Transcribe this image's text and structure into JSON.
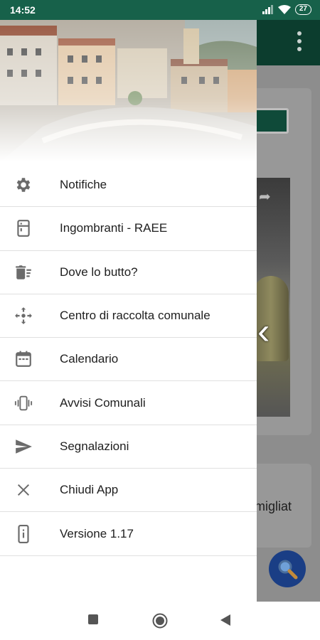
{
  "status_bar": {
    "time": "14:52",
    "battery": "27",
    "icons": [
      "signal-icon",
      "wifi-icon",
      "battery-icon"
    ]
  },
  "background_app": {
    "partial_text": "amigliat",
    "overflow_icon": "more-vertical-icon",
    "fab_icon": "search-icon",
    "toolbar_color": "#0c3d2e",
    "fab_color": "#1a3e85"
  },
  "drawer": {
    "header_image": "town-aerial-photo",
    "items": [
      {
        "label": "Notifiche",
        "icon": "gear-icon"
      },
      {
        "label": "Ingombranti - RAEE",
        "icon": "fridge-icon"
      },
      {
        "label": "Dove lo butto?",
        "icon": "trash-list-icon"
      },
      {
        "label": "Centro di raccolta comunale",
        "icon": "move-arrows-icon"
      },
      {
        "label": "Calendario",
        "icon": "calendar-icon"
      },
      {
        "label": "Avvisi Comunali",
        "icon": "vibrate-phone-icon"
      },
      {
        "label": "Segnalazioni",
        "icon": "send-icon"
      },
      {
        "label": "Chiudi App",
        "icon": "close-icon"
      },
      {
        "label": "Versione 1.17",
        "icon": "info-phone-icon"
      }
    ]
  },
  "nav_bar": {
    "buttons": [
      "recents-square-icon",
      "home-circle-icon",
      "back-triangle-icon"
    ]
  }
}
